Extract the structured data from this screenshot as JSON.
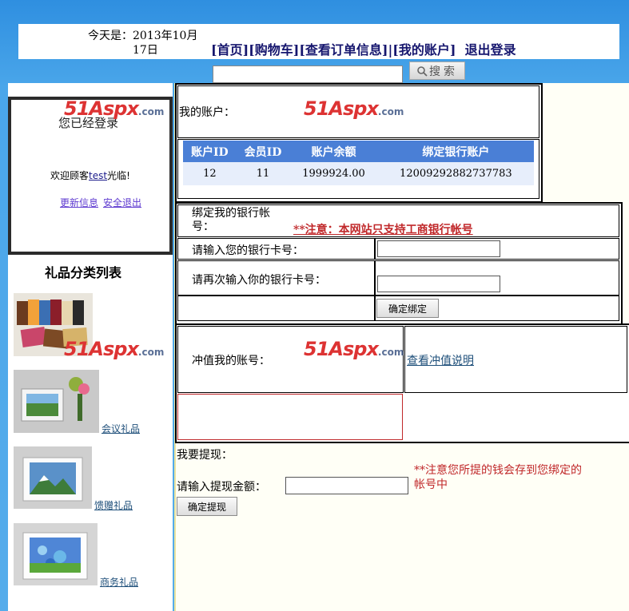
{
  "header": {
    "date_line1": "今天是：2013年10月",
    "date_line2": "17日",
    "nav": [
      "[首页]",
      "[购物车]",
      "[查看订单信息]",
      "|[我的账户]",
      "退出登录"
    ],
    "search_button": "搜索"
  },
  "sidebar": {
    "login_status": "您已经登录",
    "welcome_prefix": "欢迎顾客",
    "username": "test",
    "welcome_suffix": "光临!",
    "update_link": "更新信息",
    "logout_link": "安全退出",
    "category_title": "礼品分类列表",
    "categories": [
      {
        "label": "",
        "icon": "wallets-image"
      },
      {
        "label": "会议礼品",
        "icon": "photo-frame-image"
      },
      {
        "label": "馈赠礼品",
        "icon": "photo-frame-image"
      },
      {
        "label": "商务礼品",
        "icon": "photo-frame-image"
      }
    ]
  },
  "account": {
    "label": "我的账户：",
    "columns": [
      "账户ID",
      "会员ID",
      "账户余额",
      "绑定银行账户"
    ],
    "rows": [
      [
        "12",
        "11",
        "1999924.00",
        "12009292882737783"
      ]
    ]
  },
  "bind": {
    "title": "绑定我的银行帐号：",
    "notice": "**注意：本网站只支持工商银行帐号",
    "card_label": "请输入您的银行卡号：",
    "card_confirm_label": "请再次输入你的银行卡号：",
    "button": "确定绑定"
  },
  "recharge": {
    "label": "冲值我的账号：",
    "link": "查看冲值说明"
  },
  "withdraw": {
    "title": "我要提现：",
    "amount_label": "请输入提现金额：",
    "notice": "**注意您所提的钱会存到您绑定的帐号中",
    "button": "确定提现"
  },
  "watermark": {
    "brand": "51Aspx",
    "suffix": ".com"
  },
  "colors": {
    "accent_blue": "#4a7fd6",
    "nav_text": "#16166e",
    "warning_red": "#c0282a"
  }
}
